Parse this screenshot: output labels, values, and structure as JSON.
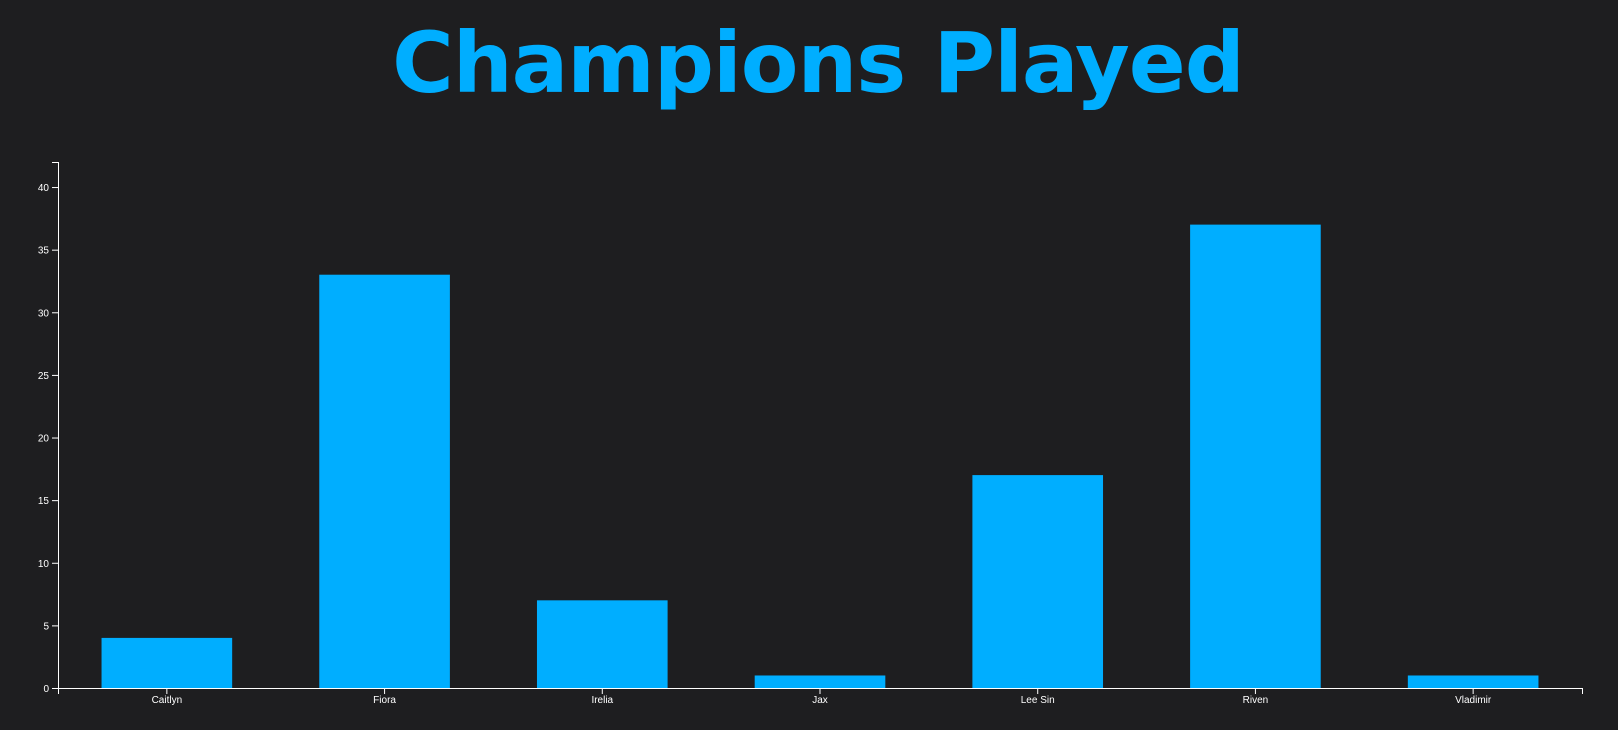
{
  "colors": {
    "background": "#1e1e20",
    "accent": "#00aeff",
    "axis": "#ffffff"
  },
  "chart_data": {
    "type": "bar",
    "title": "Champions Played",
    "xlabel": "",
    "ylabel": "",
    "categories": [
      "Caitlyn",
      "Fiora",
      "Irelia",
      "Jax",
      "Lee Sin",
      "Riven",
      "Vladimir"
    ],
    "values": [
      4,
      33,
      7,
      1,
      17,
      37,
      1
    ],
    "ylim": [
      0,
      42
    ],
    "yticks": [
      0,
      5,
      10,
      15,
      20,
      25,
      30,
      35,
      40
    ],
    "grid": false,
    "legend": "none"
  }
}
